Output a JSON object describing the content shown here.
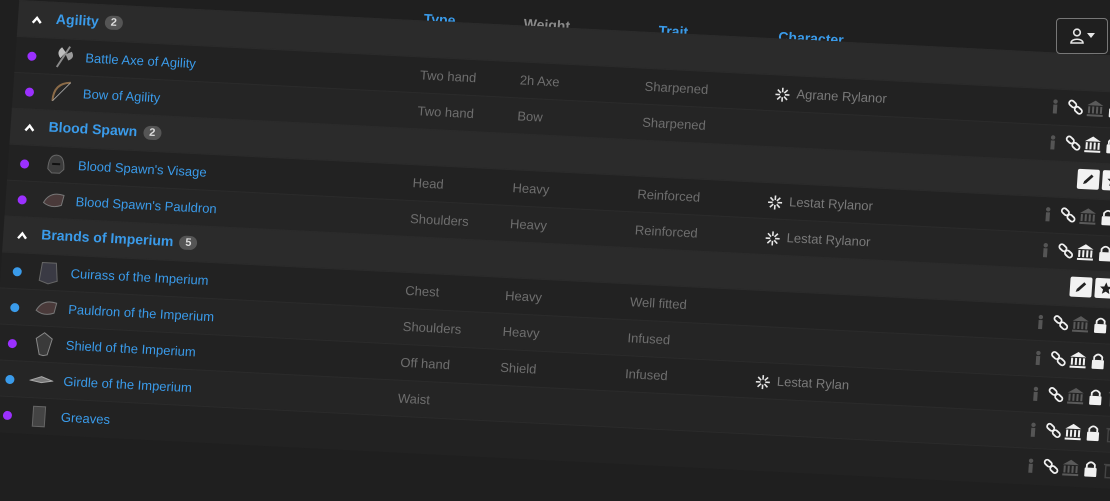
{
  "columns": {
    "type": "Type",
    "weight": "Weight",
    "trait": "Trait",
    "character": "Character"
  },
  "colors": {
    "accent": "#3a9bea",
    "purple": "#9b30ff",
    "blue": "#3a9bea"
  },
  "groups": [
    {
      "name": "Agility",
      "count": "2",
      "items": [
        {
          "name": "Battle Axe of Agility",
          "type": "Two hand",
          "weight": "2h Axe",
          "trait": "Sharpened",
          "character": "Agrane Rylanor",
          "quality": "purple",
          "icon": "axe-icon"
        },
        {
          "name": "Bow of Agility",
          "type": "Two hand",
          "weight": "Bow",
          "trait": "Sharpened",
          "character": "",
          "quality": "purple",
          "icon": "bow-icon"
        }
      ]
    },
    {
      "name": "Blood Spawn",
      "count": "2",
      "items": [
        {
          "name": "Blood Spawn's Visage",
          "type": "Head",
          "weight": "Heavy",
          "trait": "Reinforced",
          "character": "Lestat Rylanor",
          "quality": "purple",
          "icon": "helmet-icon"
        },
        {
          "name": "Blood Spawn's Pauldron",
          "type": "Shoulders",
          "weight": "Heavy",
          "trait": "Reinforced",
          "character": "Lestat Rylanor",
          "quality": "purple",
          "icon": "pauldron-icon"
        }
      ]
    },
    {
      "name": "Brands of Imperium",
      "count": "5",
      "items": [
        {
          "name": "Cuirass of the Imperium",
          "type": "Chest",
          "weight": "Heavy",
          "trait": "Well fitted",
          "character": "",
          "quality": "blue",
          "icon": "cuirass-icon"
        },
        {
          "name": "Pauldron of the Imperium",
          "type": "Shoulders",
          "weight": "Heavy",
          "trait": "Infused",
          "character": "",
          "quality": "blue",
          "icon": "pauldron-icon"
        },
        {
          "name": "Shield of the Imperium",
          "type": "Off hand",
          "weight": "Shield",
          "trait": "Infused",
          "character": "Lestat Rylan",
          "quality": "purple",
          "icon": "shield-icon"
        },
        {
          "name": "Girdle of the Imperium",
          "type": "Waist",
          "weight": "",
          "trait": "",
          "character": "",
          "quality": "blue",
          "icon": "girdle-icon"
        },
        {
          "name": "Greaves",
          "type": "",
          "weight": "",
          "trait": "",
          "character": "",
          "quality": "purple",
          "icon": "greaves-icon"
        }
      ]
    }
  ]
}
